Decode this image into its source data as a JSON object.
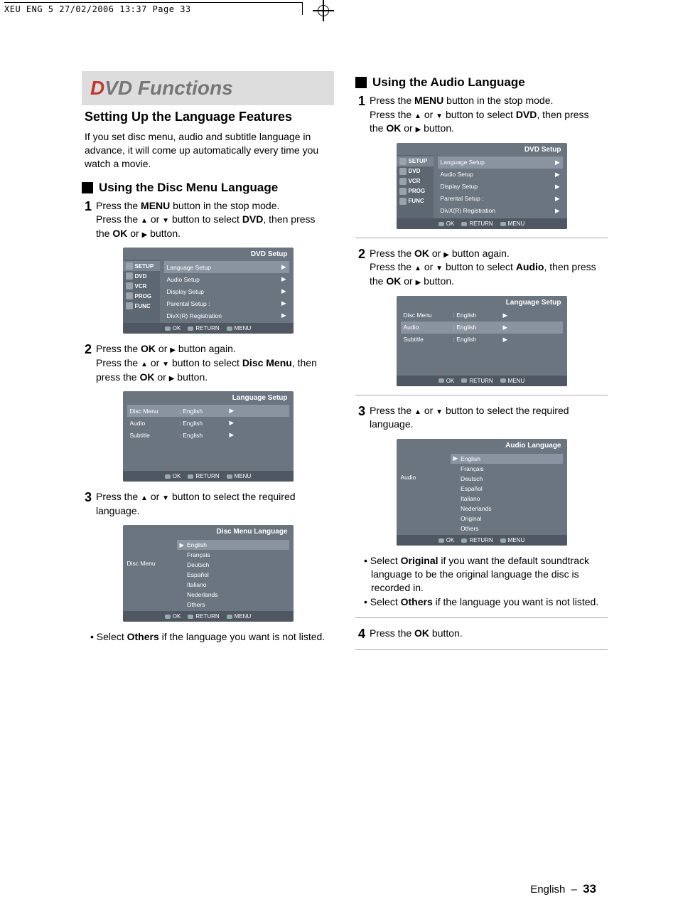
{
  "crop_header": "XEU ENG 5  27/02/2006  13:37  Page 33",
  "title": {
    "d": "D",
    "rest": "VD Functions"
  },
  "subheading": "Setting Up the Language Features",
  "intro": "If you set disc menu, audio and subtitle language in advance, it will come up automatically every time you watch a movie.",
  "left": {
    "section": "Using the Disc Menu Language",
    "step1a": "Press the ",
    "step1_menu": "MENU",
    "step1b": " button in the stop mode.",
    "step1c": "Press the ",
    "step1d": " or ",
    "step1e": " button to select ",
    "step1_dvd": "DVD",
    "step1f": ", then press the ",
    "step1_ok": "OK",
    "step1g": " or ",
    "step1h": " button.",
    "step2a": "Press the ",
    "step2_ok": "OK",
    "step2b": " or ",
    "step2c": " button again.",
    "step2d": "Press the ",
    "step2e": " or ",
    "step2f": " button to select ",
    "step2_disc": "Disc Menu",
    "step2g": ", then press the ",
    "step2_ok2": "OK",
    "step2h": " or ",
    "step2i": " button.",
    "step3a": "Press the ",
    "step3b": " or ",
    "step3c": " button to select the required language.",
    "note": "Select Others if the language you want is not listed.",
    "note_bold": "Others"
  },
  "right": {
    "section": "Using the Audio Language",
    "step1a": "Press the ",
    "step1_menu": "MENU",
    "step1b": " button in the stop mode.",
    "step1c": "Press the ",
    "step1d": " or ",
    "step1e": " button to select ",
    "step1_dvd": "DVD",
    "step1f": ", then press the ",
    "step1_ok": "OK",
    "step1g": " or ",
    "step1h": " button.",
    "step2a": "Press the ",
    "step2_ok": "OK",
    "step2b": " or ",
    "step2c": " button again.",
    "step2d": "Press the ",
    "step2e": " or ",
    "step2f": " button to select ",
    "step2_audio": "Audio",
    "step2g": ", then press the ",
    "step2_ok2": "OK",
    "step2h": " or ",
    "step2i": " button.",
    "step3a": "Press the ",
    "step3b": " or ",
    "step3c": " button to select the required language.",
    "note1": "Select Original if you want the default soundtrack language to be the original language the disc is recorded in.",
    "note1_bold": "Original",
    "note2": "Select Others if the language you want is not listed.",
    "note2_bold": "Others",
    "step4a": "Press the ",
    "step4_ok": "OK",
    "step4b": " button."
  },
  "osd_dvd_setup": {
    "title": "DVD  Setup",
    "sidebar": [
      "SETUP",
      "DVD",
      "VCR",
      "PROG",
      "FUNC"
    ],
    "rows": [
      "Language Setup",
      "Audio Setup",
      "Display Setup",
      "Parental Setup :",
      "DivX(R) Registration"
    ]
  },
  "osd_lang_setup": {
    "title": "Language Setup",
    "rows": [
      {
        "label": "Disc Menu",
        "value": ": English"
      },
      {
        "label": "Audio",
        "value": ": English"
      },
      {
        "label": "Subtitle",
        "value": ": English"
      }
    ]
  },
  "osd_disc_menu_lang": {
    "title": "Disc Menu Language",
    "left": "Disc Menu",
    "opts": [
      "English",
      "Français",
      "Deutsch",
      "Español",
      "Italiano",
      "Nederlands",
      "Others"
    ]
  },
  "osd_audio_lang": {
    "title": "Audio Language",
    "left": "Audio",
    "opts": [
      "English",
      "Français",
      "Deutsch",
      "Español",
      "Italiano",
      "Nederlands",
      "Original",
      "Others"
    ]
  },
  "osd_footer": {
    "ok": "OK",
    "return": "RETURN",
    "menu": "MENU"
  },
  "footer": {
    "label": "English",
    "page": "33"
  }
}
